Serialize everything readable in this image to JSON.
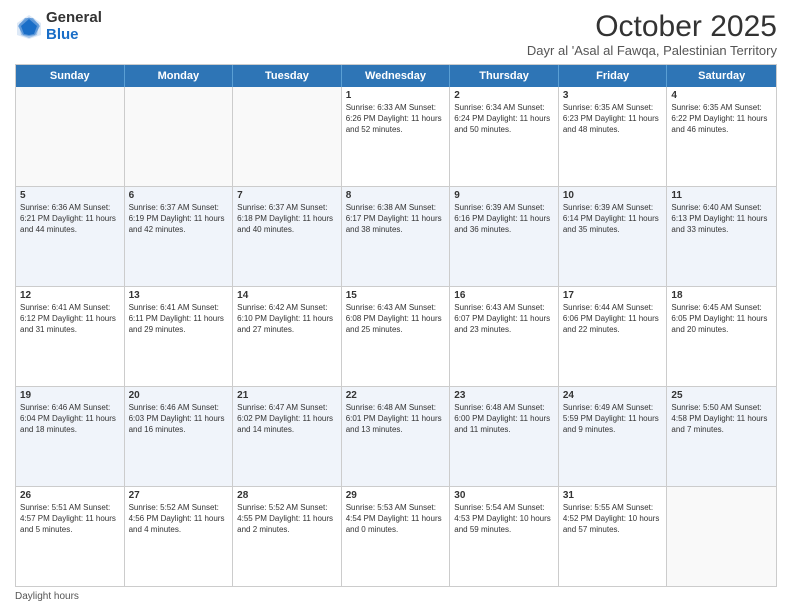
{
  "logo": {
    "general": "General",
    "blue": "Blue"
  },
  "title": "October 2025",
  "subtitle": "Dayr al 'Asal al Fawqa, Palestinian Territory",
  "days": [
    "Sunday",
    "Monday",
    "Tuesday",
    "Wednesday",
    "Thursday",
    "Friday",
    "Saturday"
  ],
  "footer": "Daylight hours",
  "weeks": [
    [
      {
        "day": "",
        "info": ""
      },
      {
        "day": "",
        "info": ""
      },
      {
        "day": "",
        "info": ""
      },
      {
        "day": "1",
        "info": "Sunrise: 6:33 AM\nSunset: 6:26 PM\nDaylight: 11 hours\nand 52 minutes."
      },
      {
        "day": "2",
        "info": "Sunrise: 6:34 AM\nSunset: 6:24 PM\nDaylight: 11 hours\nand 50 minutes."
      },
      {
        "day": "3",
        "info": "Sunrise: 6:35 AM\nSunset: 6:23 PM\nDaylight: 11 hours\nand 48 minutes."
      },
      {
        "day": "4",
        "info": "Sunrise: 6:35 AM\nSunset: 6:22 PM\nDaylight: 11 hours\nand 46 minutes."
      }
    ],
    [
      {
        "day": "5",
        "info": "Sunrise: 6:36 AM\nSunset: 6:21 PM\nDaylight: 11 hours\nand 44 minutes."
      },
      {
        "day": "6",
        "info": "Sunrise: 6:37 AM\nSunset: 6:19 PM\nDaylight: 11 hours\nand 42 minutes."
      },
      {
        "day": "7",
        "info": "Sunrise: 6:37 AM\nSunset: 6:18 PM\nDaylight: 11 hours\nand 40 minutes."
      },
      {
        "day": "8",
        "info": "Sunrise: 6:38 AM\nSunset: 6:17 PM\nDaylight: 11 hours\nand 38 minutes."
      },
      {
        "day": "9",
        "info": "Sunrise: 6:39 AM\nSunset: 6:16 PM\nDaylight: 11 hours\nand 36 minutes."
      },
      {
        "day": "10",
        "info": "Sunrise: 6:39 AM\nSunset: 6:14 PM\nDaylight: 11 hours\nand 35 minutes."
      },
      {
        "day": "11",
        "info": "Sunrise: 6:40 AM\nSunset: 6:13 PM\nDaylight: 11 hours\nand 33 minutes."
      }
    ],
    [
      {
        "day": "12",
        "info": "Sunrise: 6:41 AM\nSunset: 6:12 PM\nDaylight: 11 hours\nand 31 minutes."
      },
      {
        "day": "13",
        "info": "Sunrise: 6:41 AM\nSunset: 6:11 PM\nDaylight: 11 hours\nand 29 minutes."
      },
      {
        "day": "14",
        "info": "Sunrise: 6:42 AM\nSunset: 6:10 PM\nDaylight: 11 hours\nand 27 minutes."
      },
      {
        "day": "15",
        "info": "Sunrise: 6:43 AM\nSunset: 6:08 PM\nDaylight: 11 hours\nand 25 minutes."
      },
      {
        "day": "16",
        "info": "Sunrise: 6:43 AM\nSunset: 6:07 PM\nDaylight: 11 hours\nand 23 minutes."
      },
      {
        "day": "17",
        "info": "Sunrise: 6:44 AM\nSunset: 6:06 PM\nDaylight: 11 hours\nand 22 minutes."
      },
      {
        "day": "18",
        "info": "Sunrise: 6:45 AM\nSunset: 6:05 PM\nDaylight: 11 hours\nand 20 minutes."
      }
    ],
    [
      {
        "day": "19",
        "info": "Sunrise: 6:46 AM\nSunset: 6:04 PM\nDaylight: 11 hours\nand 18 minutes."
      },
      {
        "day": "20",
        "info": "Sunrise: 6:46 AM\nSunset: 6:03 PM\nDaylight: 11 hours\nand 16 minutes."
      },
      {
        "day": "21",
        "info": "Sunrise: 6:47 AM\nSunset: 6:02 PM\nDaylight: 11 hours\nand 14 minutes."
      },
      {
        "day": "22",
        "info": "Sunrise: 6:48 AM\nSunset: 6:01 PM\nDaylight: 11 hours\nand 13 minutes."
      },
      {
        "day": "23",
        "info": "Sunrise: 6:48 AM\nSunset: 6:00 PM\nDaylight: 11 hours\nand 11 minutes."
      },
      {
        "day": "24",
        "info": "Sunrise: 6:49 AM\nSunset: 5:59 PM\nDaylight: 11 hours\nand 9 minutes."
      },
      {
        "day": "25",
        "info": "Sunrise: 5:50 AM\nSunset: 4:58 PM\nDaylight: 11 hours\nand 7 minutes."
      }
    ],
    [
      {
        "day": "26",
        "info": "Sunrise: 5:51 AM\nSunset: 4:57 PM\nDaylight: 11 hours\nand 5 minutes."
      },
      {
        "day": "27",
        "info": "Sunrise: 5:52 AM\nSunset: 4:56 PM\nDaylight: 11 hours\nand 4 minutes."
      },
      {
        "day": "28",
        "info": "Sunrise: 5:52 AM\nSunset: 4:55 PM\nDaylight: 11 hours\nand 2 minutes."
      },
      {
        "day": "29",
        "info": "Sunrise: 5:53 AM\nSunset: 4:54 PM\nDaylight: 11 hours\nand 0 minutes."
      },
      {
        "day": "30",
        "info": "Sunrise: 5:54 AM\nSunset: 4:53 PM\nDaylight: 10 hours\nand 59 minutes."
      },
      {
        "day": "31",
        "info": "Sunrise: 5:55 AM\nSunset: 4:52 PM\nDaylight: 10 hours\nand 57 minutes."
      },
      {
        "day": "",
        "info": ""
      }
    ]
  ]
}
